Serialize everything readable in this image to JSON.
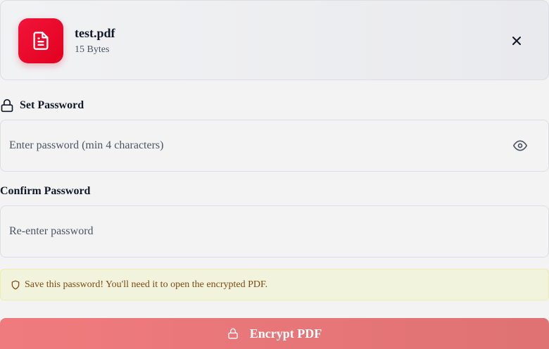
{
  "file": {
    "name": "test.pdf",
    "size": "15 Bytes",
    "icon": "document-icon",
    "icon_color": "#e8102e"
  },
  "close": {
    "icon": "close-icon"
  },
  "password": {
    "label": "Set Password",
    "placeholder": "Enter password (min 4 characters)",
    "value": "",
    "label_icon": "lock-icon",
    "toggle_icon": "eye-icon"
  },
  "confirm": {
    "label": "Confirm Password",
    "placeholder": "Re-enter password",
    "value": ""
  },
  "notice": {
    "icon": "shield-icon",
    "text": "Save this password! You'll need it to open the encrypted PDF.",
    "background": "#f1f3dc",
    "text_color": "#7c4a12"
  },
  "encrypt": {
    "label": "Encrypt PDF",
    "icon": "lock-icon",
    "color": "#ec7778"
  }
}
